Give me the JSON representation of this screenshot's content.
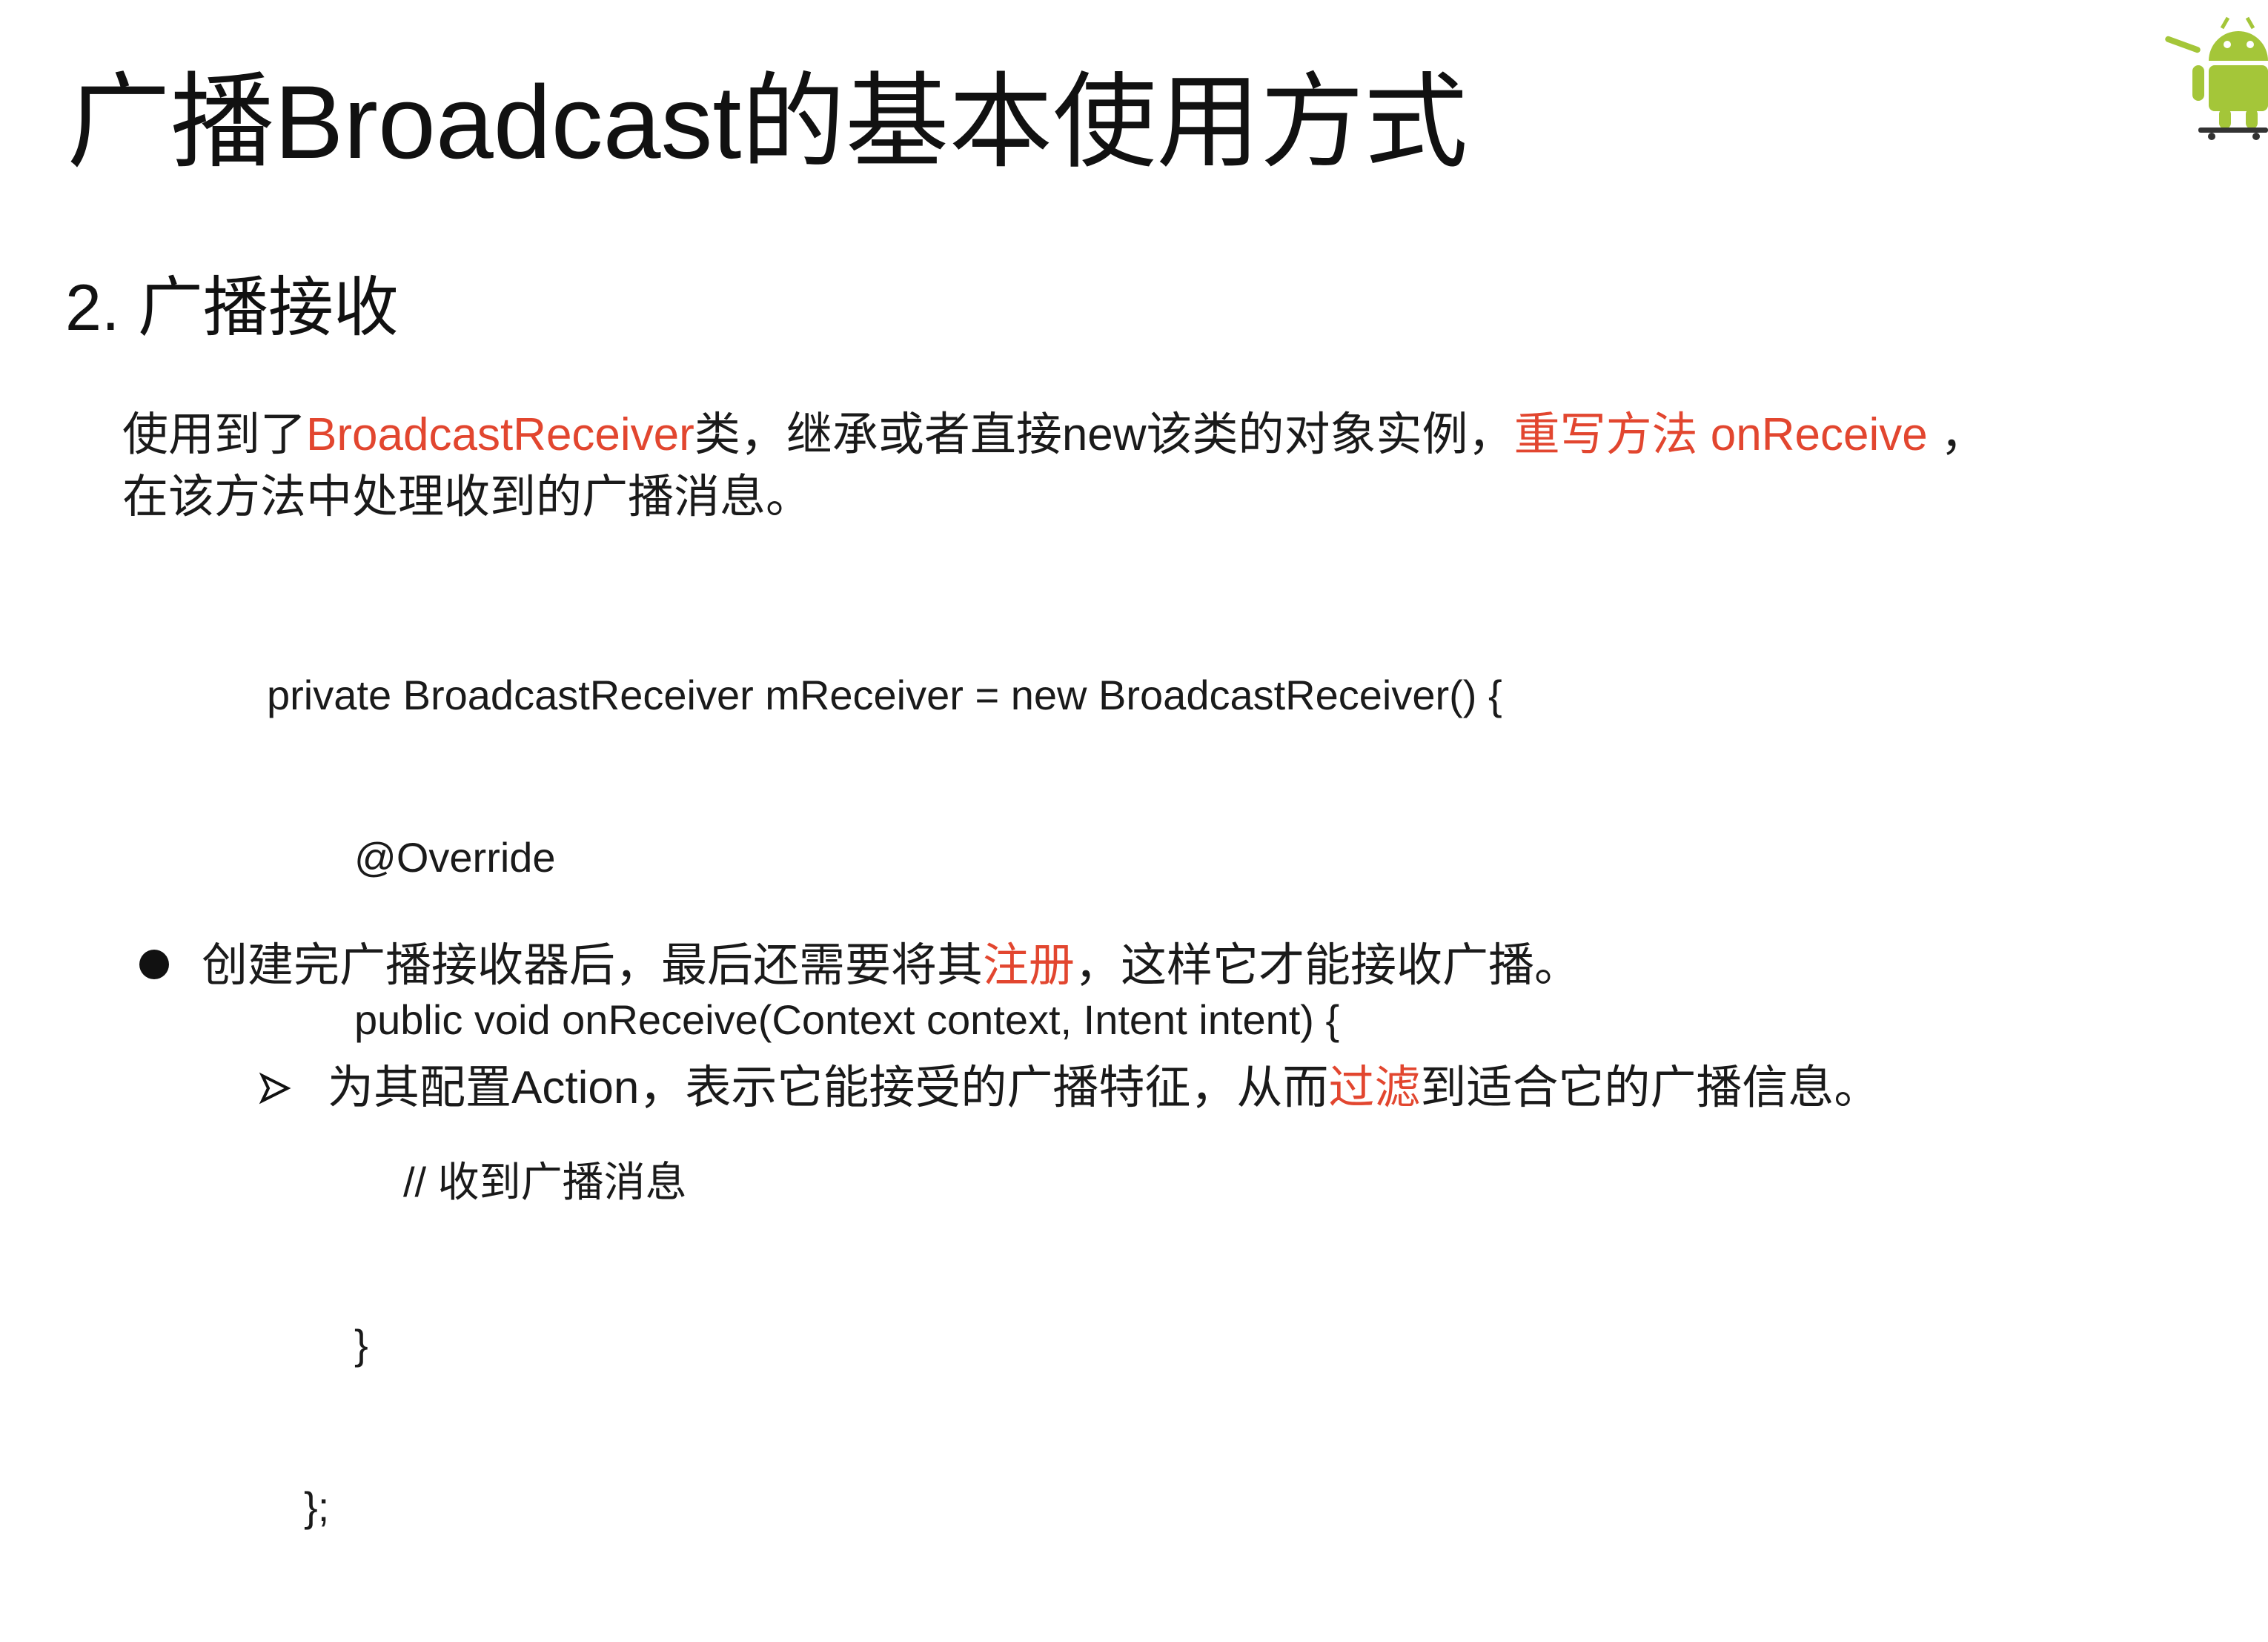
{
  "slide": {
    "title": "广播Broadcast的基本使用方式",
    "section_heading": "2. 广播接收",
    "intro": {
      "line1": {
        "prefix": "使用到了",
        "highlight1": "BroadcastReceiver",
        "middle": "类，继承或者直接new该类的对象实例，",
        "highlight2": "重写方法 onReceive",
        "suffix": " ，"
      },
      "line2": "在该方法中处理收到的广播消息。"
    },
    "code_lines": [
      "private BroadcastReceiver mReceiver = new BroadcastReceiver() {",
      "@Override",
      "public void onReceive(Context context, Intent intent) {",
      "// 收到广播消息",
      "}",
      "};"
    ],
    "bullet": {
      "prefix": "创建完广播接收器后，最后还需要将其",
      "highlight": "注册",
      "suffix": "，这样它才能接收广播。"
    },
    "sub_bullet": {
      "prefix": "为其配置Action，表示它能接受的广播特征，从而",
      "highlight": "过滤",
      "suffix": "到适合它的广播信息。"
    },
    "accent_color": "#e2462f",
    "logo_icon": "android-mascot-icon"
  }
}
